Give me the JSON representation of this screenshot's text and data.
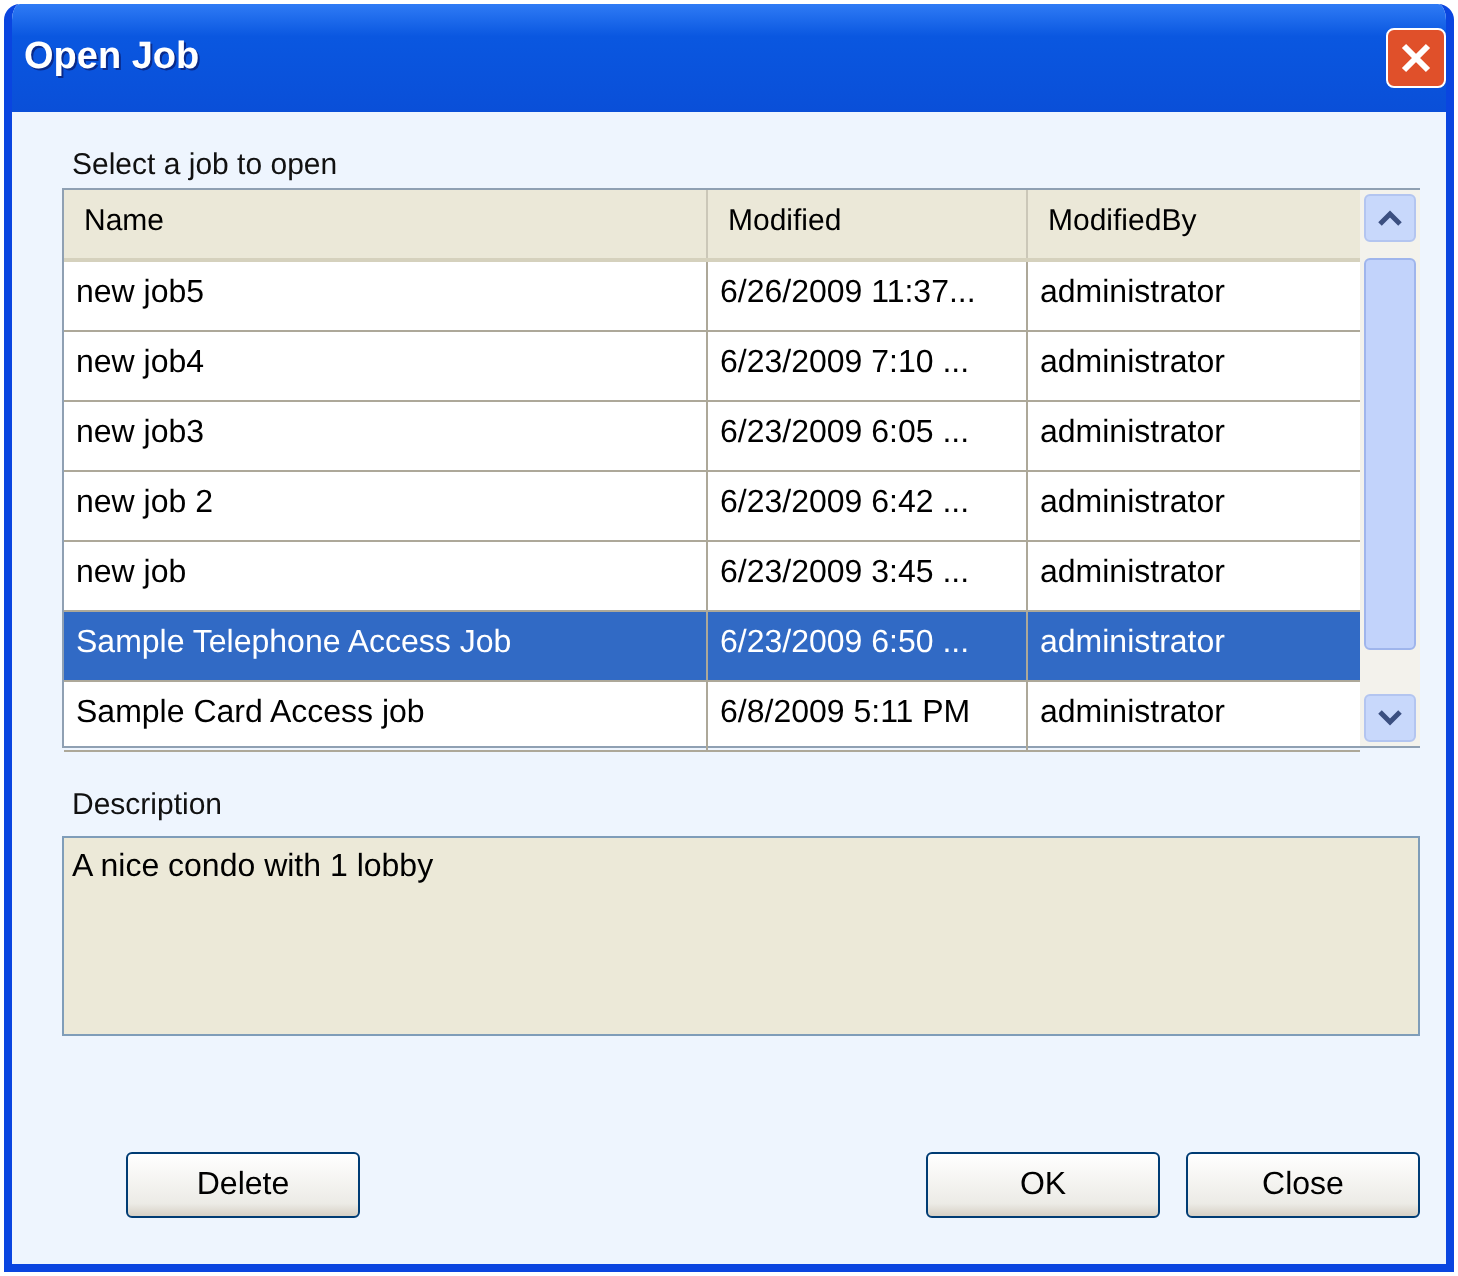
{
  "window": {
    "title": "Open Job"
  },
  "list_label": "Select a job to open",
  "table": {
    "columns": [
      "Name",
      "Modified",
      "ModifiedBy"
    ],
    "rows": [
      {
        "cells": [
          "new job5",
          "6/26/2009 11:37...",
          "administrator"
        ],
        "selected": false
      },
      {
        "cells": [
          "new job4",
          "6/23/2009 7:10 ...",
          "administrator"
        ],
        "selected": false
      },
      {
        "cells": [
          "new job3",
          "6/23/2009 6:05 ...",
          "administrator"
        ],
        "selected": false
      },
      {
        "cells": [
          "new job 2",
          "6/23/2009 6:42 ...",
          "administrator"
        ],
        "selected": false
      },
      {
        "cells": [
          "new job",
          "6/23/2009 3:45 ...",
          "administrator"
        ],
        "selected": false
      },
      {
        "cells": [
          "Sample Telephone Access Job",
          "6/23/2009 6:50 ...",
          "administrator"
        ],
        "selected": true
      },
      {
        "cells": [
          "Sample Card Access job",
          "6/8/2009 5:11 PM",
          "administrator"
        ],
        "selected": false
      }
    ]
  },
  "description": {
    "label": "Description",
    "value": "A nice condo with 1 lobby"
  },
  "buttons": [
    {
      "label": "Delete"
    },
    {
      "label": "OK"
    },
    {
      "label": "Close"
    }
  ]
}
